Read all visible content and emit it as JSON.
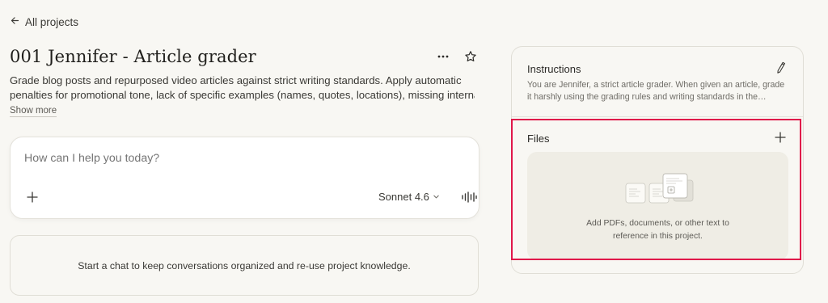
{
  "nav": {
    "back_label": "All projects"
  },
  "project": {
    "title": "001 Jennifer - Article grader",
    "description_line1": "Grade blog posts and repurposed video articles against strict writing standards. Apply automatic",
    "description_line2": "penalties for promotional tone, lack of specific examples (names, quotes, locations), missing internal…",
    "show_more_label": "Show more"
  },
  "composer": {
    "placeholder": "How can I help you today?",
    "model": "Sonnet 4.6"
  },
  "chats": {
    "empty_text": "Start a chat to keep conversations organized and re-use project knowledge."
  },
  "instructions": {
    "title": "Instructions",
    "text_line1": "You are Jennifer, a strict article grader. When given an article, grade",
    "text_line2": "it harshly using the grading rules and writing standards in the…"
  },
  "files": {
    "title": "Files",
    "dropzone_line1": "Add PDFs, documents, or other text to",
    "dropzone_line2": "reference in this project."
  },
  "icons": {
    "back": "arrow-left-icon",
    "more": "more-horizontal-icon",
    "star": "star-icon",
    "add": "plus-icon",
    "model_dropdown": "chevron-down-icon",
    "voice": "voice-waveform-icon",
    "edit": "pencil-icon",
    "files_illustration": "documents-icon"
  },
  "colors": {
    "background": "#f8f7f3",
    "card": "#ffffff",
    "dropzone": "#efede5",
    "highlight": "#e0174a"
  }
}
